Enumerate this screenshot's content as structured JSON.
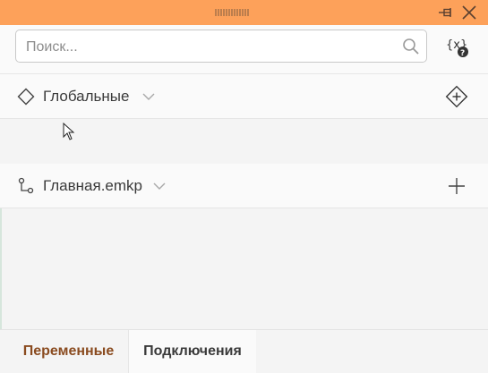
{
  "colors": {
    "titlebar": "#fda15a",
    "active_tab_text": "#8a4b1f",
    "text": "#3a3a3a"
  },
  "titlebar": {
    "icons": [
      "grip-icon",
      "pin-icon",
      "close-icon"
    ]
  },
  "search": {
    "placeholder": "Поиск...",
    "value": "",
    "icon": "search-icon",
    "variable_button_icon": "variable-help-icon"
  },
  "sections": {
    "globals": {
      "label": "Глобальные",
      "icon": "diamond-icon",
      "action_icon": "add-diamond-icon"
    },
    "main": {
      "label": "Главная.emkp",
      "icon": "flow-icon",
      "action_icon": "plus-icon"
    }
  },
  "tabs": [
    {
      "label": "Переменные",
      "active": true
    },
    {
      "label": "Подключения",
      "active": false
    }
  ]
}
